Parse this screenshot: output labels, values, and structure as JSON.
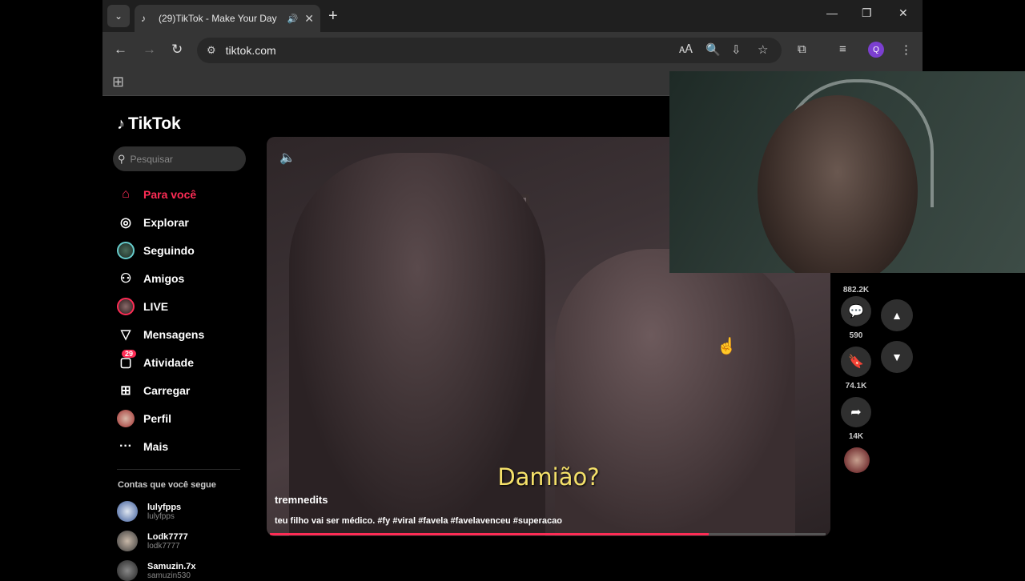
{
  "browser": {
    "tab_title": "(29)TikTok - Make Your Day",
    "url": "tiktok.com",
    "profile_initial": "Q"
  },
  "tiktok": {
    "logo_text": "TikTok",
    "search_placeholder": "Pesquisar",
    "menu": [
      {
        "label": "Para você",
        "icon": "home-icon",
        "active": true
      },
      {
        "label": "Explorar",
        "icon": "compass-icon"
      },
      {
        "label": "Seguindo",
        "icon": "following-avatar-icon"
      },
      {
        "label": "Amigos",
        "icon": "friends-icon"
      },
      {
        "label": "LIVE",
        "icon": "live-avatar-icon"
      },
      {
        "label": "Mensagens",
        "icon": "send-icon"
      },
      {
        "label": "Atividade",
        "icon": "activity-icon",
        "badge": "29"
      },
      {
        "label": "Carregar",
        "icon": "upload-icon"
      },
      {
        "label": "Perfil",
        "icon": "profile-avatar-icon"
      },
      {
        "label": "Mais",
        "icon": "more-icon"
      }
    ],
    "following_title": "Contas que você segue",
    "following": [
      {
        "name": "lulyfpps",
        "handle": "lulyfpps"
      },
      {
        "name": "Lodk7777",
        "handle": "lodk7777"
      },
      {
        "name": "Samuzin.7x",
        "handle": "samuzin530"
      }
    ],
    "video": {
      "subtitle": "Damião?",
      "author": "tremnedits",
      "caption": "teu filho vai ser médico. #fy #viral #favela #favelavenceu #superacao",
      "progress": 0.79
    },
    "actions": {
      "likes": "882.2K",
      "comments": "590",
      "saves": "74.1K",
      "shares": "14K"
    }
  }
}
